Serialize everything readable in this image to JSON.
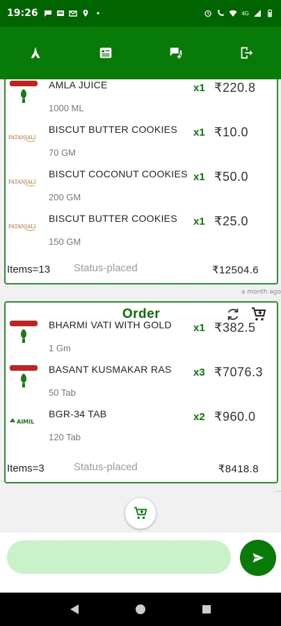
{
  "status_bar": {
    "time": "19:26",
    "network": "4G"
  },
  "app_bar": {
    "icons": [
      "namaste-icon",
      "list-icon",
      "chat-add-icon",
      "logout-icon"
    ]
  },
  "orders": [
    {
      "title": "",
      "items": [
        {
          "name": "AMLA JUICE",
          "size": "1000 ML",
          "qty": "x1",
          "price": "₹220.8",
          "logo": "vaidya-logo"
        },
        {
          "name": "BISCUT BUTTER COOKIES",
          "size": "70 GM",
          "qty": "x1",
          "price": "₹10.0",
          "logo": "patanjali-logo"
        },
        {
          "name": "BISCUT COCONUT COOKIES",
          "size": "200 GM",
          "qty": "x1",
          "price": "₹50.0",
          "logo": "patanjali-logo"
        },
        {
          "name": "BISCUT BUTTER COOKIES",
          "size": "150 GM",
          "qty": "x1",
          "price": "₹25.0",
          "logo": "patanjali-logo"
        }
      ],
      "items_count": "Items=13",
      "status": "Status-placed",
      "total": "₹12504.6",
      "timestamp": "a month ago"
    },
    {
      "title": "Order",
      "items": [
        {
          "name": "BHARMI VATI WITH GOLD",
          "size": "1 Gm",
          "qty": "x1",
          "price": "₹382.5",
          "logo": "vaidya-logo"
        },
        {
          "name": "BASANT KUSMAKAR RAS",
          "size": "50 Tab",
          "qty": "x3",
          "price": "₹7076.3",
          "logo": "vaidya-logo"
        },
        {
          "name": "BGR-34 TAB",
          "size": "120 Tab",
          "qty": "x2",
          "price": "₹960.0",
          "logo": "aimil-logo"
        }
      ],
      "items_count": "Items=3",
      "status": "Status-placed",
      "total": "₹8418.8",
      "timestamp": "..."
    }
  ],
  "message_input": {
    "value": "",
    "placeholder": ""
  },
  "colors": {
    "primary": "#087a08",
    "status_bar": "#006400",
    "input_bg": "#c9f2c9",
    "qty_green": "#0a7a0a"
  }
}
